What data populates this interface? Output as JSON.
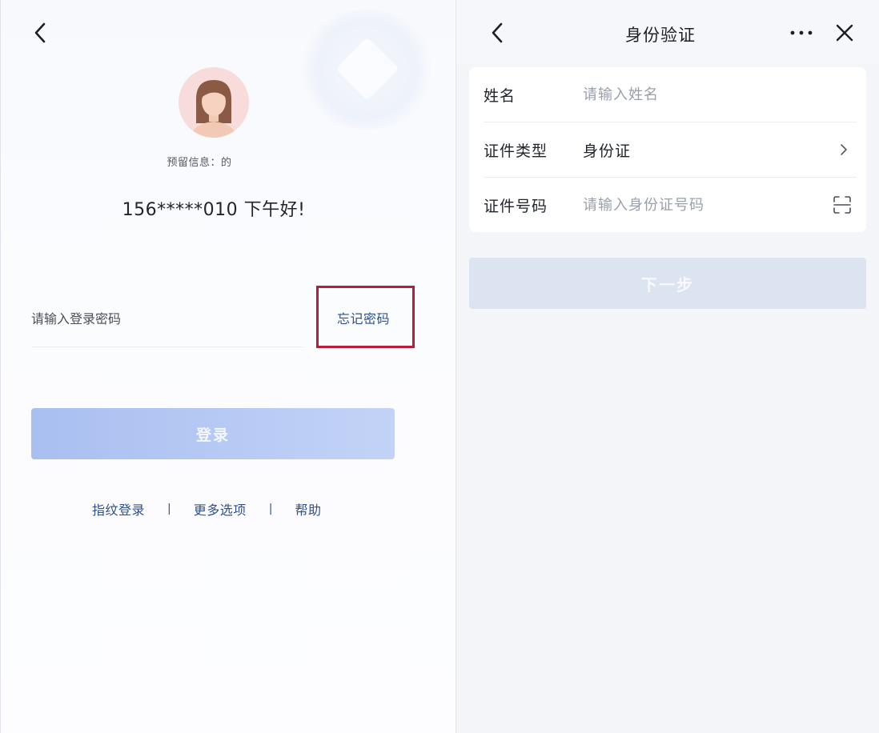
{
  "login": {
    "reserved_info": "预留信息：的",
    "greeting": "156*****010  下午好!",
    "password_placeholder": "请输入登录密码",
    "forgot_password": "忘记密码",
    "login_button": "登录",
    "links": [
      {
        "label": "指纹登录"
      },
      {
        "label": "更多选项"
      },
      {
        "label": "帮助"
      }
    ],
    "separator": "|"
  },
  "verify": {
    "title": "身份验证",
    "fields": {
      "name": {
        "label": "姓名",
        "placeholder": "请输入姓名"
      },
      "id_type": {
        "label": "证件类型",
        "value": "身份证"
      },
      "id_number": {
        "label": "证件号码",
        "placeholder": "请输入身份证号码"
      }
    },
    "next_button": "下一步"
  },
  "icons": {
    "back": "chevron-left-icon",
    "more": "more-dots-icon",
    "close": "close-icon",
    "chevron": "chevron-right-icon",
    "scan": "scan-icon"
  },
  "colors": {
    "highlight_box": "#b51d3b",
    "link": "#2e4f91",
    "login_button": "#b6c9f4",
    "next_button": "#dbe4f0"
  }
}
